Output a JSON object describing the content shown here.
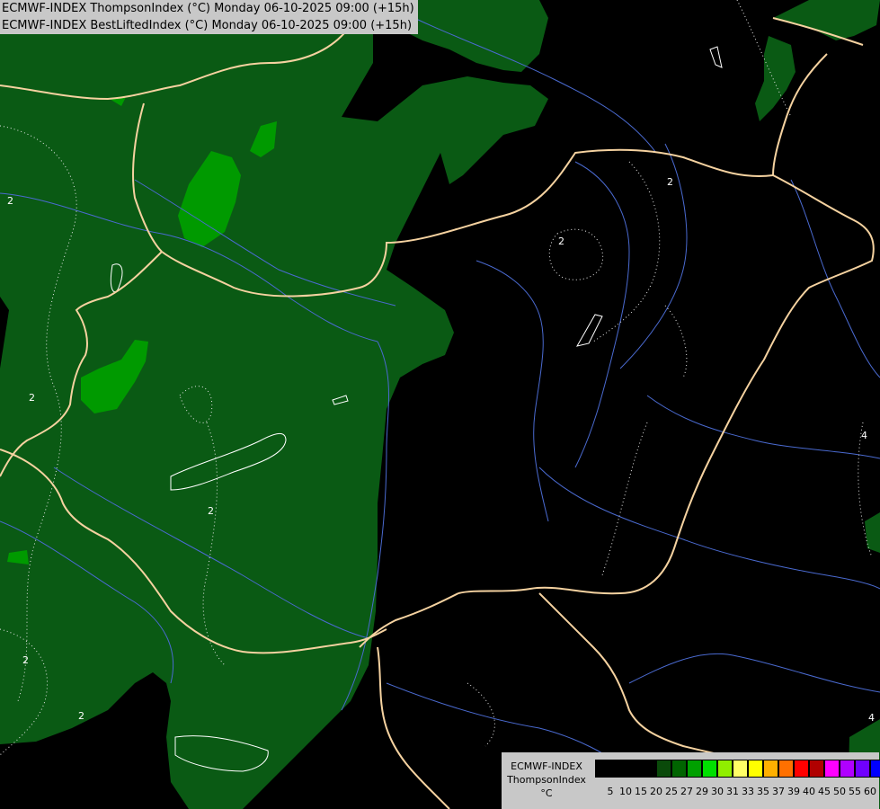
{
  "header": {
    "line1": "ECMWF-INDEX ThompsonIndex (°C) Monday 06-10-2025 09:00 (+15h)",
    "line2": "ECMWF-INDEX BestLiftedIndex (°C) Monday 06-10-2025 09:00 (+15h)"
  },
  "legend": {
    "title_line1": "ECMWF-INDEX",
    "title_line2": "ThompsonIndex",
    "unit": "°C",
    "ticks": [
      "5",
      "10",
      "15",
      "20",
      "25",
      "27",
      "29",
      "30",
      "31",
      "33",
      "35",
      "37",
      "39",
      "40",
      "45",
      "50",
      "55",
      "60"
    ],
    "colors": [
      "#000000",
      "#000000",
      "#000000",
      "#000000",
      "#0a4a0a",
      "#006400",
      "#00a000",
      "#00e000",
      "#90ee00",
      "#ffff66",
      "#ffff00",
      "#ffb000",
      "#ff7000",
      "#ff0000",
      "#b00000",
      "#ff00ff",
      "#b000ff",
      "#7000ff",
      "#0000ff"
    ]
  },
  "contour_labels": [
    "2",
    "2",
    "2",
    "2",
    "2",
    "2",
    "2",
    "4",
    "4"
  ],
  "colors": {
    "dark_green": "#0a5a14",
    "mid_green": "#009a00",
    "border": "#f5d2a0",
    "river": "#4a6ad0",
    "background": "#000000"
  }
}
